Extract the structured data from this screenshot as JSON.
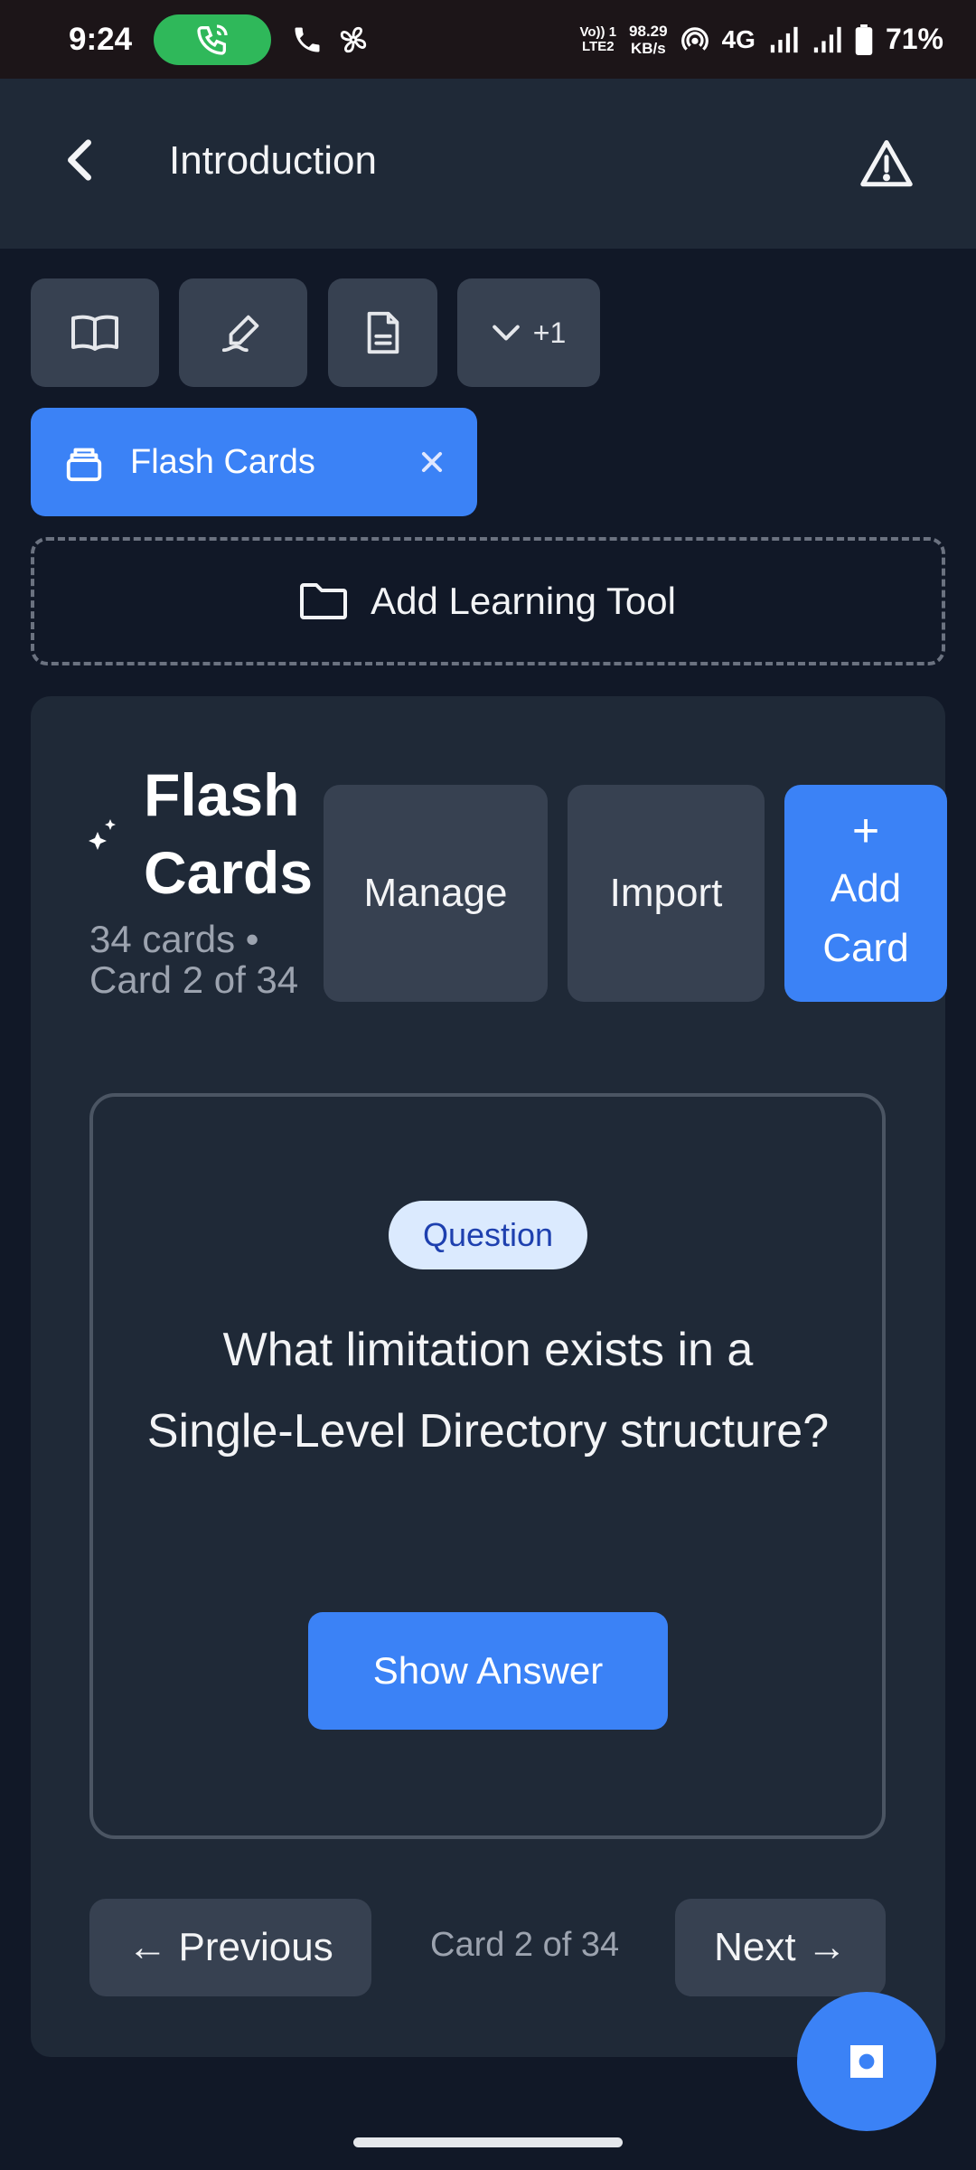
{
  "status_bar": {
    "time": "9:24",
    "volte_top": "Vo)) 1",
    "volte_bottom": "LTE2",
    "speed_value": "98.29",
    "speed_unit": "KB/s",
    "network": "4G",
    "battery": "71%"
  },
  "app_bar": {
    "title": "Introduction"
  },
  "tools": {
    "more_label": "+1",
    "active_chip_label": "Flash Cards",
    "add_tool_label": "Add Learning Tool"
  },
  "flashcards": {
    "title": "Flash Cards",
    "meta_line1": "34 cards •",
    "meta_line2": "Card 2 of 34",
    "manage_label": "Manage",
    "import_label": "Import",
    "add_plus": "+",
    "add_line1": "Add",
    "add_line2": "Card",
    "badge": "Question",
    "question": "What limitation exists in a Single-Level Directory structure?",
    "show_answer": "Show Answer",
    "previous": "← Previous",
    "counter": "Card 2 of 34",
    "next": "Next →"
  },
  "colors": {
    "accent": "#3b82f6",
    "background": "#111827",
    "surface": "#1f2937",
    "button": "#374151",
    "call_green": "#2fb85a"
  }
}
